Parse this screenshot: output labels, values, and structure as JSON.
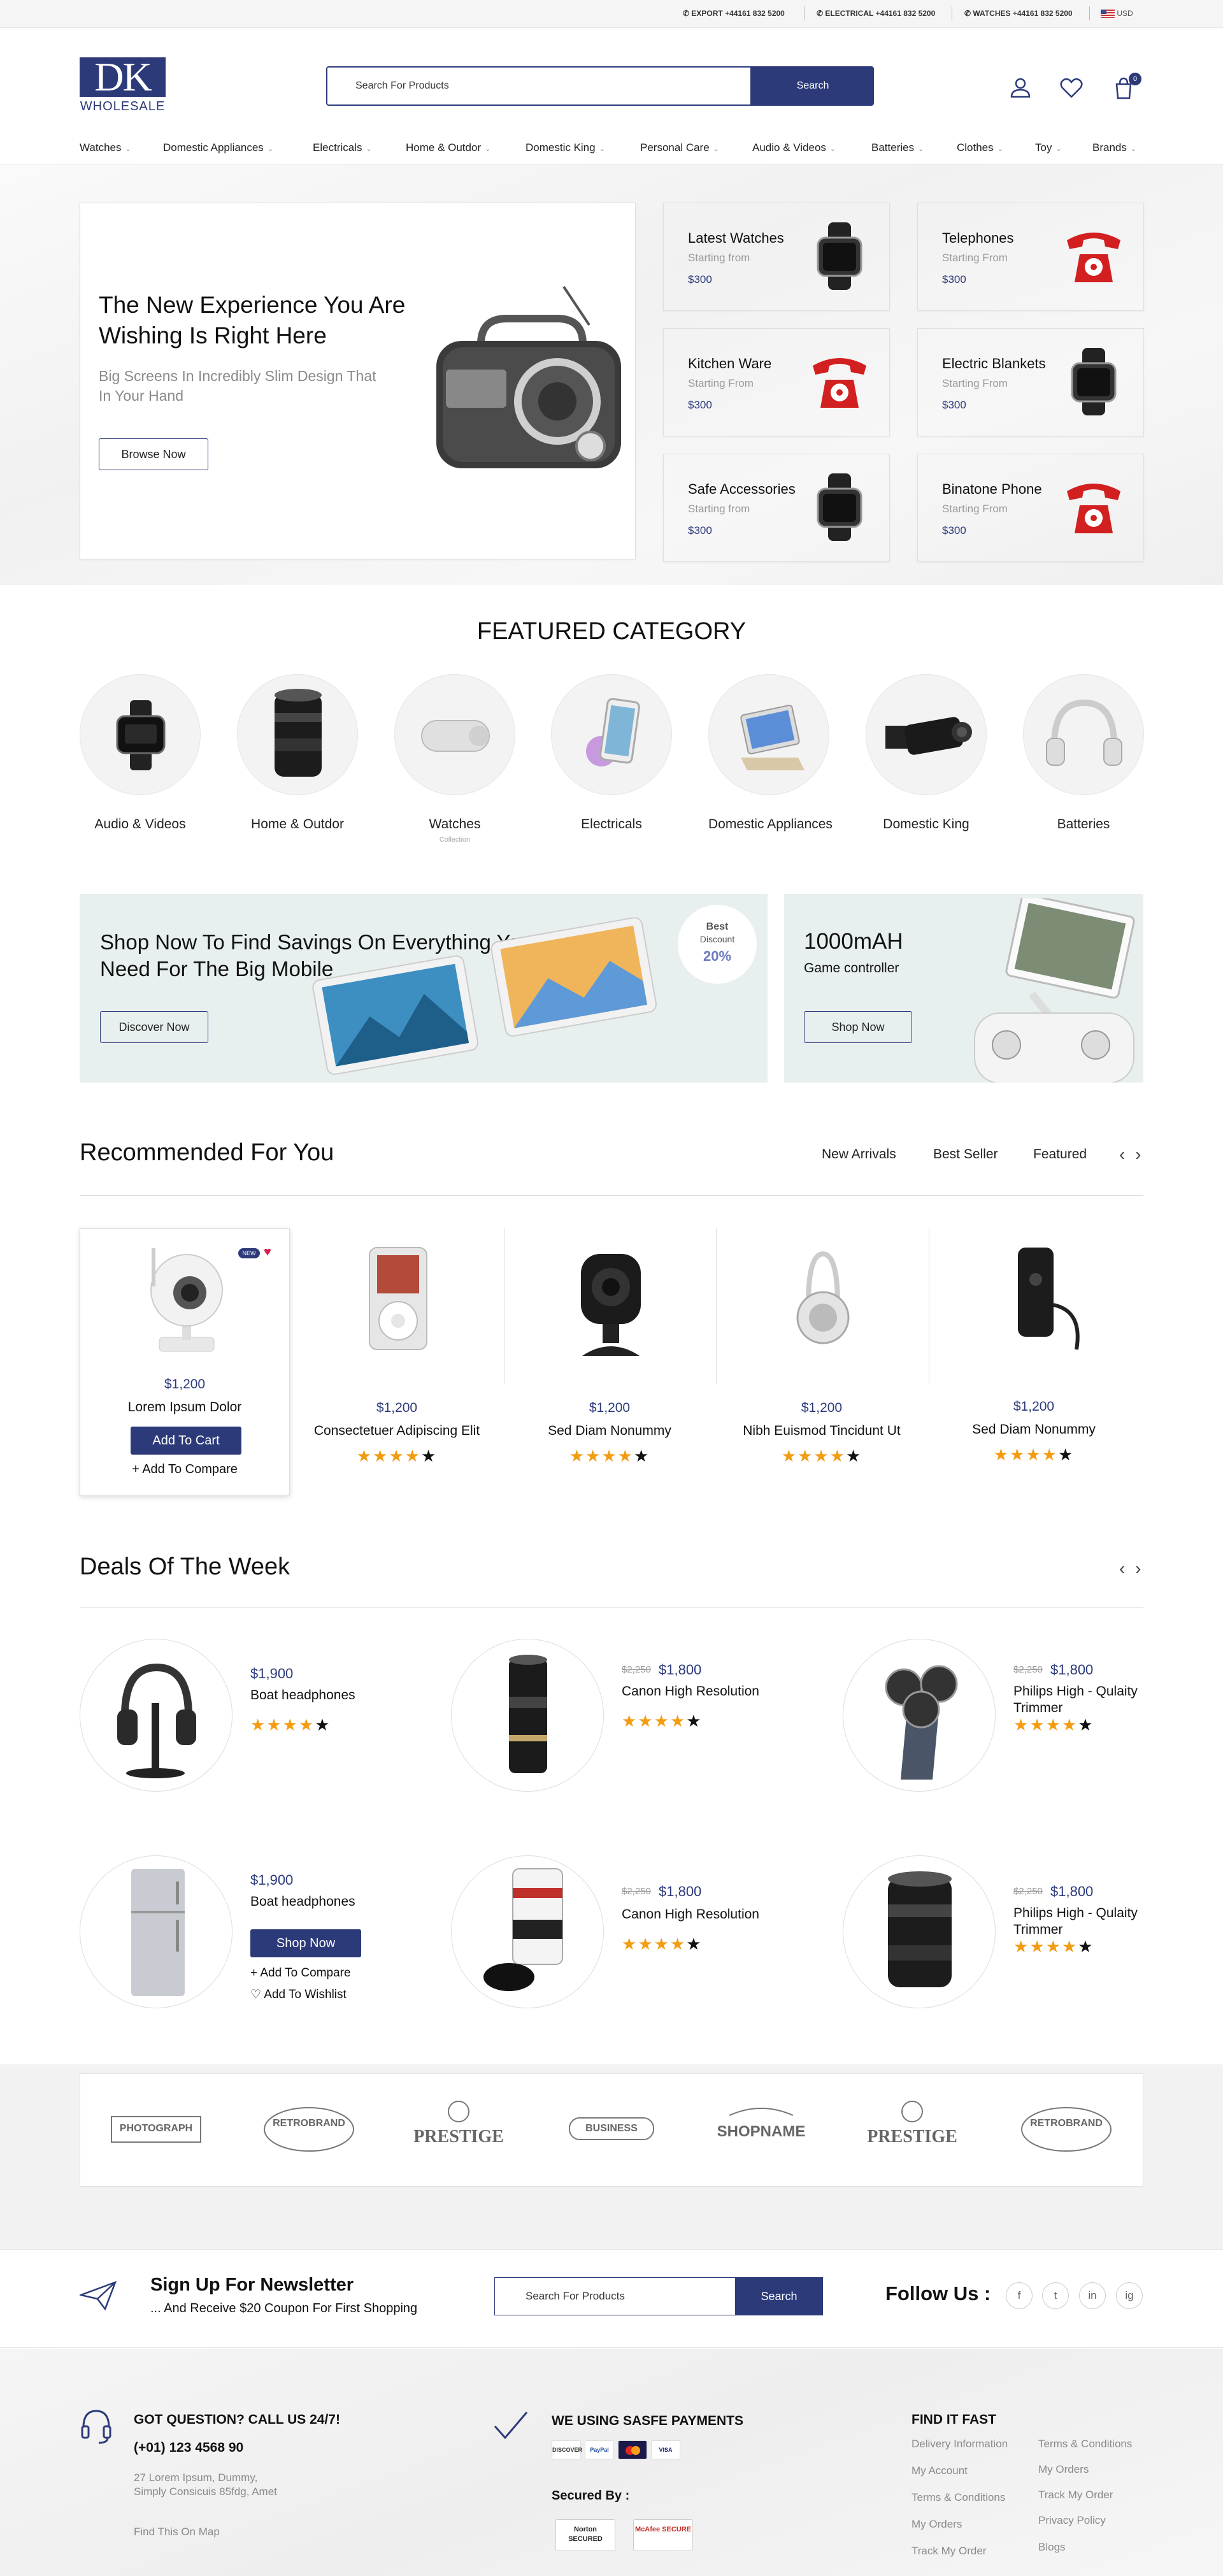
{
  "topbar": {
    "items": [
      {
        "label": "EXPORT",
        "phone": "+44161 832 5200"
      },
      {
        "label": "ELECTRICAL",
        "phone": "+44161 832 5200"
      },
      {
        "label": "WATCHES",
        "phone": "+44161 832 5200"
      }
    ],
    "currency": "USD"
  },
  "header": {
    "logo_main": "DK",
    "logo_sub": "WHOLESALE",
    "search_placeholder": "Search For Products",
    "search_button": "Search",
    "cart_count": "0"
  },
  "nav": {
    "items": [
      "Watches",
      "Domestic Appliances",
      "Electricals",
      "Home & Outdor",
      "Domestic King",
      "Personal Care",
      "Audio & Videos",
      "Batteries",
      "Clothes",
      "Toy",
      "Brands"
    ]
  },
  "hero": {
    "title": "The New Experience You Are Wishing Is Right Here",
    "subtitle": "Big Screens In Incredibly Slim Design That In Your Hand",
    "button": "Browse Now"
  },
  "cards": [
    {
      "title": "Latest Watches",
      "sub": "Starting from",
      "price": "$300",
      "icon": "smartwatch-icon",
      "bg": "#f5f5f5"
    },
    {
      "title": "Telephones",
      "sub": "Starting From",
      "price": "$300",
      "icon": "red-telephone-icon",
      "bg": "#e4eded"
    },
    {
      "title": "Kitchen Ware",
      "sub": "Starting From",
      "price": "$300",
      "icon": "red-telephone-icon",
      "bg": "#e4eded"
    },
    {
      "title": "Electric Blankets",
      "sub": "Starting From",
      "price": "$300",
      "icon": "smartwatch-icon",
      "bg": "#f5f5f5"
    },
    {
      "title": "Safe Accessories",
      "sub": "Starting from",
      "price": "$300",
      "icon": "smartwatch-icon",
      "bg": "#f5f5f5"
    },
    {
      "title": "Binatone Phone",
      "sub": "Starting From",
      "price": "$300",
      "icon": "red-telephone-icon",
      "bg": "#e4eded"
    }
  ],
  "featured": {
    "title": "FEATURED CATEGORY",
    "items": [
      {
        "label": "Audio & Videos",
        "icon": "fitness-band-icon"
      },
      {
        "label": "Home & Outdor",
        "icon": "camera-lens-icon"
      },
      {
        "label": "Watches",
        "icon": "speaker-icon",
        "sub": "Collection"
      },
      {
        "label": "Electricals",
        "icon": "smartphone-icon"
      },
      {
        "label": "Domestic Appliances",
        "icon": "tablet-icon"
      },
      {
        "label": "Domestic King",
        "icon": "cctv-camera-icon"
      },
      {
        "label": "Batteries",
        "icon": "headphones-icon"
      }
    ]
  },
  "banner1": {
    "title": "Shop Now To Find Savings On Everything You Need For The Big Mobile",
    "button": "Discover Now",
    "badge_line1": "Best",
    "badge_line2": "Discount",
    "badge_value": "20%"
  },
  "banner2": {
    "title": "1000mAH",
    "subtitle": "Game controller",
    "button": "Shop Now"
  },
  "recommended": {
    "title": "Recommended For You",
    "tabs": [
      "New Arrivals",
      "Best Seller",
      "Featured"
    ],
    "products": [
      {
        "price": "$1,200",
        "name": "Lorem Ipsum Dolor",
        "icon": "security-camera-icon",
        "badge": "NEW",
        "cart": "Add To Cart",
        "compare": "+ Add To Compare"
      },
      {
        "price": "$1,200",
        "name": "Consectetuer Adipiscing Elit",
        "icon": "ipod-icon",
        "rating": 4
      },
      {
        "price": "$1,200",
        "name": "Sed Diam Nonummy",
        "icon": "webcam-icon",
        "rating": 4
      },
      {
        "price": "$1,200",
        "name": "Nibh Euismod Tincidunt Ut",
        "icon": "headphones-icon",
        "rating": 4
      },
      {
        "price": "$1,200",
        "name": "Sed Diam Nonummy",
        "icon": "bluetooth-headset-icon",
        "rating": 4
      }
    ]
  },
  "deals": {
    "title": "Deals Of The Week",
    "items": [
      {
        "price": "$1,900",
        "name": "Boat headphones",
        "rating": 4,
        "icon": "headphones-stand-icon"
      },
      {
        "old": "$2,250",
        "price": "$1,800",
        "name": "Canon High Resolution",
        "rating": 4,
        "icon": "telephoto-lens-icon"
      },
      {
        "old": "$2,250",
        "price": "$1,800",
        "name": "Philips High - Qulaity Trimmer",
        "rating": 4,
        "icon": "shaver-icon"
      },
      {
        "price": "$1,900",
        "name": "Boat headphones",
        "icon": "refrigerator-icon",
        "shop": "Shop Now",
        "compare": "+ Add To Compare",
        "wishlist": "Add To Wishlist"
      },
      {
        "old": "$2,250",
        "price": "$1,800",
        "name": "Canon High Resolution",
        "rating": 4,
        "icon": "lens-cap-icon"
      },
      {
        "old": "$2,250",
        "price": "$1,800",
        "name": "Philips High - Qulaity Trimmer",
        "rating": 4,
        "icon": "camera-lens-icon"
      }
    ]
  },
  "brands": [
    "PHOTOGRAPH",
    "RETROBRAND",
    "PRESTIGE",
    "BUSINESS",
    "SHOPNAME",
    "PRESTIGE",
    "RETROBRAND"
  ],
  "newsletter": {
    "title": "Sign Up For Newsletter",
    "subtitle": "... And Receive $20 Coupon For First Shopping",
    "placeholder": "Search For Products",
    "button": "Search",
    "follow": "Follow Us :",
    "social": [
      "f",
      "t",
      "in",
      "ig"
    ]
  },
  "footer": {
    "call_title": "GOT QUESTION? CALL US 24/7!",
    "phone": "(+01) 123 4568 90",
    "address1": "27 Lorem Ipsum, Dummy,",
    "address2": "Simply Consicuis 85fdg, Amet",
    "map": "Find This On Map",
    "pay_title": "WE USING SASFE PAYMENTS",
    "payments": [
      "DISCOVER",
      "PayPal",
      "MC",
      "VISA"
    ],
    "secured": "Secured By :",
    "badges": [
      "Norton SECURED",
      "McAfee SECURE"
    ],
    "find_title": "FIND IT FAST",
    "links_col1": [
      "Delivery Information",
      "My Account",
      "Terms & Conditions",
      "My Orders",
      "Track My Order"
    ],
    "links_col2": [
      "Terms & Conditions",
      "My Orders",
      "Track My Order",
      "Privacy Policy",
      "Blogs"
    ]
  },
  "colors": {
    "brand": "#2c3a7a",
    "star": "#f39c12",
    "heart": "#d6204e"
  }
}
